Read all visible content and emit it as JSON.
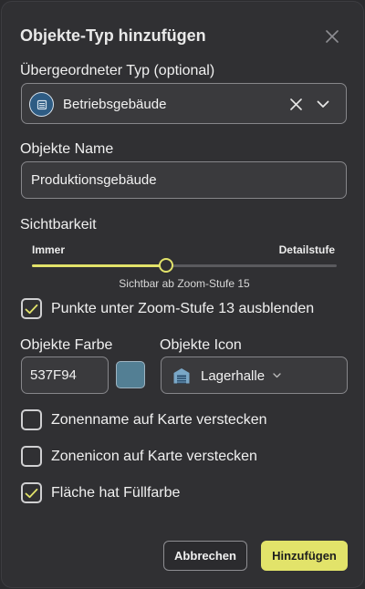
{
  "dialog": {
    "title": "Objekte-Typ hinzufügen",
    "close_icon": "close-icon"
  },
  "parent_type": {
    "label": "Übergeordneter Typ (optional)",
    "value": "Betriebsgebäude",
    "avatar_icon": "building-icon",
    "avatar_color": "#2e5c84",
    "clear_icon": "clear-icon",
    "dropdown_icon": "chevron-down-icon"
  },
  "object_name": {
    "label": "Objekte Name",
    "value": "Produktionsgebäude"
  },
  "visibility": {
    "label": "Sichtbarkeit",
    "min_label": "Immer",
    "max_label": "Detailstufe",
    "level_fraction": 0.44,
    "caption": "Sichtbar ab Zoom-Stufe 15"
  },
  "hide_points": {
    "label": "Punkte unter Zoom-Stufe 13 ausblenden",
    "checked": true
  },
  "object_color": {
    "label": "Objekte Farbe",
    "value": "537F94",
    "swatch_color": "#537f94"
  },
  "object_icon": {
    "label": "Objekte Icon",
    "value": "Lagerhalle",
    "icon": "warehouse-icon",
    "dropdown_icon": "chevron-down-icon"
  },
  "hide_zone_name": {
    "label": "Zonenname auf Karte verstecken",
    "checked": false
  },
  "hide_zone_icon": {
    "label": "Zonenicon auf Karte verstecken",
    "checked": false
  },
  "area_fill": {
    "label": "Fläche hat Füllfarbe",
    "checked": true
  },
  "actions": {
    "cancel_label": "Abbrechen",
    "submit_label": "Hinzufügen"
  },
  "colors": {
    "accent": "#e2e36a",
    "background": "#303033"
  }
}
